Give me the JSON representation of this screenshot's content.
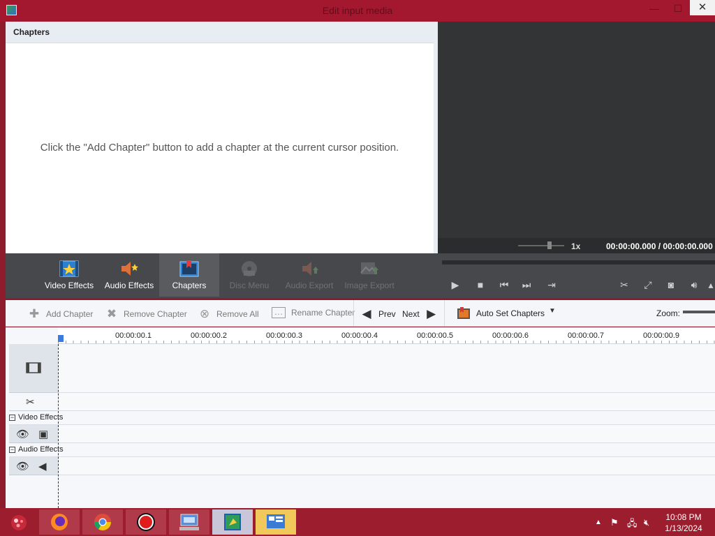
{
  "window": {
    "title": "Edit input media"
  },
  "chapters_panel": {
    "header": "Chapters",
    "hint": "Click the \"Add Chapter\" button to add a chapter at the current cursor position."
  },
  "preview": {
    "speed": "1x",
    "time": "00:00:00.000 / 00:00:00.000"
  },
  "toolbar": {
    "items": [
      {
        "label": "Video Effects",
        "icon": "video-effects-icon",
        "state": "enabled"
      },
      {
        "label": "Audio Effects",
        "icon": "audio-effects-icon",
        "state": "enabled"
      },
      {
        "label": "Chapters",
        "icon": "chapters-icon",
        "state": "active"
      },
      {
        "label": "Disc Menu",
        "icon": "disc-menu-icon",
        "state": "disabled"
      },
      {
        "label": "Audio Export",
        "icon": "audio-export-icon",
        "state": "disabled"
      },
      {
        "label": "Image Export",
        "icon": "image-export-icon",
        "state": "disabled"
      }
    ]
  },
  "actions": {
    "add_chapter": "Add Chapter",
    "remove_chapter": "Remove Chapter",
    "remove_all": "Remove All",
    "rename_chapter": "Rename Chapter",
    "prev": "Prev",
    "next": "Next",
    "auto_set": "Auto Set Chapters",
    "zoom": "Zoom:"
  },
  "timeline": {
    "ticks": [
      "00:00:00.1",
      "00:00:00.2",
      "00:00:00.3",
      "00:00:00.4",
      "00:00:00.5",
      "00:00:00.6",
      "00:00:00.7",
      "00:00:00.9"
    ],
    "groups": {
      "video_effects": "Video Effects",
      "audio_effects": "Audio Effects"
    }
  },
  "taskbar": {
    "time": "10:08 PM",
    "date": "1/13/2024"
  },
  "colors": {
    "titlebar": "#a3182e",
    "taskbar": "#9c1d2e",
    "toolbar": "#47484b",
    "preview": "#333436",
    "cursor": "#3b7be0"
  }
}
